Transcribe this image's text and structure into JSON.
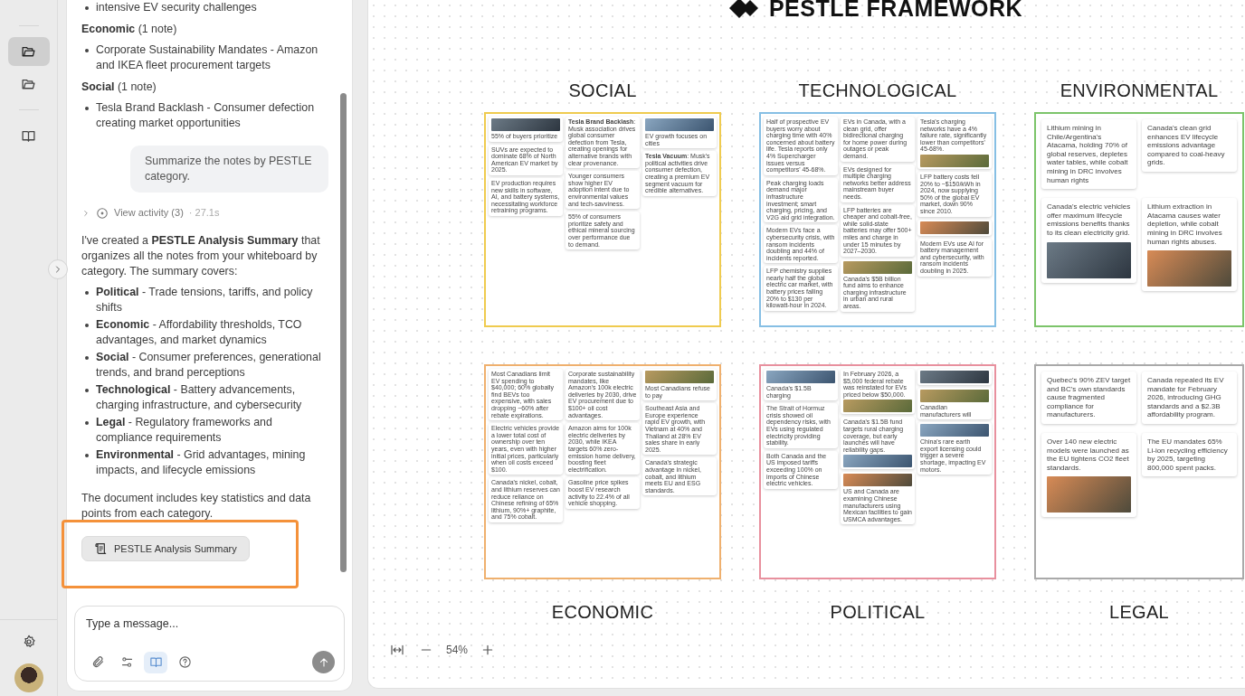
{
  "rail": {
    "items": [
      {
        "kind": "folder",
        "selected": true
      },
      {
        "kind": "folder",
        "selected": false
      },
      {
        "kind": "book",
        "selected": false
      }
    ],
    "bottom": [
      {
        "kind": "settings"
      },
      {
        "kind": "avatar"
      }
    ]
  },
  "chat": {
    "items": [
      {
        "kind": "bullet",
        "text": "intensive EV security challenges"
      },
      {
        "kind": "heading",
        "text": "**Economic** (1 note)"
      },
      {
        "kind": "bullet",
        "text": "Corporate Sustainability Mandates - Amazon and IKEA fleet procurement targets"
      },
      {
        "kind": "heading",
        "text": "**Social** (1 note)"
      },
      {
        "kind": "bullet",
        "text": "Tesla Brand Backlash - Consumer defection creating market opportunities"
      },
      {
        "kind": "user",
        "text": "Summarize the notes by PESTLE category."
      },
      {
        "kind": "activity",
        "text": "View activity (3)",
        "duration": "· 27.1s"
      },
      {
        "kind": "paragraph",
        "text": "I've created a **PESTLE Analysis Summary** that organizes all the notes from your whiteboard by category. The summary covers:"
      },
      {
        "kind": "bullet",
        "text": "**Political** - Trade tensions, tariffs, and policy shifts"
      },
      {
        "kind": "bullet",
        "text": "**Economic** - Affordability thresholds, TCO advantages, and market dynamics"
      },
      {
        "kind": "bullet",
        "text": "**Social** - Consumer preferences, generational trends, and brand perceptions"
      },
      {
        "kind": "bullet",
        "text": "**Technological** - Battery advancements, charging infrastructure, and cybersecurity"
      },
      {
        "kind": "bullet",
        "text": "**Legal** - Regulatory frameworks and compliance requirements"
      },
      {
        "kind": "bullet",
        "text": "**Environmental** - Grid advantages, mining impacts, and lifecycle emissions"
      },
      {
        "kind": "paragraph",
        "text": "The document includes key statistics and data points from each category."
      },
      {
        "kind": "attachment",
        "text": "PESTLE Analysis Summary",
        "highlighted": true
      }
    ],
    "composer": {
      "placeholder": "Type a message...",
      "tools": [
        {
          "kind": "attach",
          "selected": false
        },
        {
          "kind": "sliders",
          "selected": false
        },
        {
          "kind": "book",
          "selected": true
        },
        {
          "kind": "help",
          "selected": false
        }
      ]
    }
  },
  "board": {
    "title": "PESTLE FRAMEWORK",
    "zoom": "54%",
    "rows": [
      {
        "frames": [
          {
            "label": "SOCIAL",
            "color": "#efcb4f",
            "notes": [
              {
                "kind": "photo-top",
                "text": "55% of buyers prioritize"
              },
              {
                "kind": "text",
                "text": "**Tesla Brand Backlash**: Musk association drives global consumer defection from Tesla, creating openings for alternative brands with clear provenance."
              },
              {
                "kind": "photo-top",
                "text": "EV growth focuses on cities"
              },
              {
                "kind": "text",
                "text": "SUVs are expected to dominate 68% of North American EV market by 2025."
              },
              {
                "kind": "text",
                "text": "Younger consumers show higher EV adoption intent due to environmental values and tech-savviness."
              },
              {
                "kind": "text",
                "text": "**Tesla Vacuum**: Musk's political activities drive consumer defection, creating a premium EV segment vacuum for credible alternatives."
              },
              {
                "kind": "text",
                "text": "EV production requires new skills in software, AI, and battery systems, necessitating workforce retraining programs."
              },
              {
                "kind": "text",
                "text": "55% of consumers prioritize safety and ethical mineral sourcing over performance due to demand."
              }
            ]
          },
          {
            "label": "TECHNOLOGICAL",
            "color": "#86bfe4",
            "notes": [
              {
                "kind": "text",
                "text": "Half of prospective EV buyers worry about charging time with 40% concerned about battery life. Tesla reports only 4% Supercharger issues versus competitors' 45-68%."
              },
              {
                "kind": "text",
                "text": "EVs in Canada, with a clean grid, offer bidirectional charging for home power during outages or peak demand."
              },
              {
                "kind": "photo-bottom",
                "text": "Tesla's charging networks have a 4% failure rate, significantly lower than competitors' 45-68%."
              },
              {
                "kind": "text",
                "text": "Peak charging loads demand major infrastructure investment; smart charging, pricing, and V2G aid grid integration."
              },
              {
                "kind": "text",
                "text": "EVs designed for multiple charging networks better address mainstream buyer needs."
              },
              {
                "kind": "text",
                "text": "LFP battery costs fell 20% to ~$150/kWh in 2024, now supplying 50% of the global EV market, down 90% since 2010."
              },
              {
                "kind": "text",
                "text": "Modern EVs face a cybersecurity crisis, with ransom incidents doubling and 44% of incidents reported."
              },
              {
                "kind": "text",
                "text": "LFP batteries are cheaper and cobalt-free, while solid-state batteries may offer 500+ miles and charge in under 15 minutes by 2027–2030."
              },
              {
                "kind": "photo-only"
              },
              {
                "kind": "text",
                "text": "LFP chemistry supplies nearly half the global electric car market, with battery prices falling 20% to $130 per kilowatt-hour in 2024."
              },
              {
                "kind": "photo-top",
                "text": "Canada's $5B billion fund aims to enhance charging infrastructure in urban and rural areas."
              },
              {
                "kind": "text",
                "text": "Modern EVs use AI for battery management and cybersecurity, with ransom incidents doubling in 2025."
              }
            ]
          },
          {
            "label": "ENVIRONMENTAL",
            "color": "#7cc46a",
            "notes": [
              {
                "kind": "text",
                "text": "Lithium mining in Chile/Argentina's Atacama, holding 70% of global reserves, depletes water tables, while cobalt mining in DRC involves human rights"
              },
              {
                "kind": "text",
                "text": "Canada's clean grid enhances EV lifecycle emissions advantage compared to coal-heavy grids."
              },
              {
                "kind": "photo-bottom",
                "text": "Canada's electric vehicles offer maximum lifecycle emissions benefits thanks to its clean electricity grid."
              },
              {
                "kind": "photo-bottom",
                "text": "Lithium extraction in Atacama causes water depletion, while cobalt mining in DRC involves human rights abuses."
              }
            ]
          }
        ]
      },
      {
        "frames": [
          {
            "label": "ECONOMIC",
            "color": "#efb06e",
            "notes": [
              {
                "kind": "text",
                "text": "Most Canadians limit EV spending to $40,000; 60% globally find BEVs too expensive, with sales dropping ~60% after rebate expirations."
              },
              {
                "kind": "text",
                "text": "Corporate sustainability mandates, like Amazon's 100k electric deliveries by 2030, drive EV procurement due to $100+ oil cost advantages."
              },
              {
                "kind": "photo-top",
                "text": "Most Canadians refuse to pay"
              },
              {
                "kind": "text",
                "text": "Electric vehicles provide a lower total cost of ownership over ten years, even with higher initial prices, particularly when oil costs exceed $100."
              },
              {
                "kind": "text",
                "text": "Amazon aims for 100k electric deliveries by 2030, while IKEA targets 60% zero-emission home delivery, boosting fleet electrification."
              },
              {
                "kind": "text",
                "text": "Southeast Asia and Europe experience rapid EV growth, with Vietnam at 40% and Thailand at 28% EV sales share in early 2025."
              },
              {
                "kind": "text",
                "text": "Canada's nickel, cobalt, and lithium reserves can reduce reliance on Chinese refining of 65% lithium, 90%+ graphite, and 75% cobalt."
              },
              {
                "kind": "text",
                "text": "Gasoline price spikes boost EV research activity to 22.4% of all vehicle shopping."
              },
              {
                "kind": "text",
                "text": "Canada's strategic advantage in nickel, cobalt, and lithium meets EU and ESG standards."
              }
            ]
          },
          {
            "label": "POLITICAL",
            "color": "#e8909e",
            "notes": [
              {
                "kind": "photo-top",
                "text": "Canada's $1.5B charging"
              },
              {
                "kind": "photo-bottom",
                "text": "In February 2026, a $5,000 federal rebate was reinstated for EVs priced below $50,000."
              },
              {
                "kind": "photo-only"
              },
              {
                "kind": "text",
                "text": "The Strait of Hormuz crisis showed oil dependency risks, with EVs using regulated electricity providing stability."
              },
              {
                "kind": "photo-bottom",
                "text": "Canada's $1.5B fund targets rural charging coverage, but early launches will have reliability gaps."
              },
              {
                "kind": "photo-top",
                "text": "Canadian manufacturers will"
              },
              {
                "kind": "text",
                "text": "Both Canada and the US imposed tariffs exceeding 100% on imports of Chinese electric vehicles."
              },
              {
                "kind": "photo-top",
                "text": "US and Canada are examining Chinese manufacturers using Mexican facilities to gain USMCA advantages."
              },
              {
                "kind": "photo-top",
                "text": "China's rare earth export licensing could trigger a severe shortage, impacting EV motors."
              }
            ]
          },
          {
            "label": "LEGAL",
            "color": "#a9a9a9",
            "notes": [
              {
                "kind": "text",
                "text": "Quebec's 90% ZEV target and BC's own standards cause fragmented compliance for manufacturers."
              },
              {
                "kind": "text",
                "text": "Canada repealed its EV mandate for February 2026, introducing GHG standards and a $2.3B affordability program."
              },
              {
                "kind": "photo-bottom",
                "text": "Over 140 new electric models were launched as the EU tightens CO2 fleet standards."
              },
              {
                "kind": "text",
                "text": "The EU mandates 65% Li-ion recycling efficiency by 2025, targeting 800,000 spent packs."
              }
            ]
          }
        ]
      }
    ]
  }
}
